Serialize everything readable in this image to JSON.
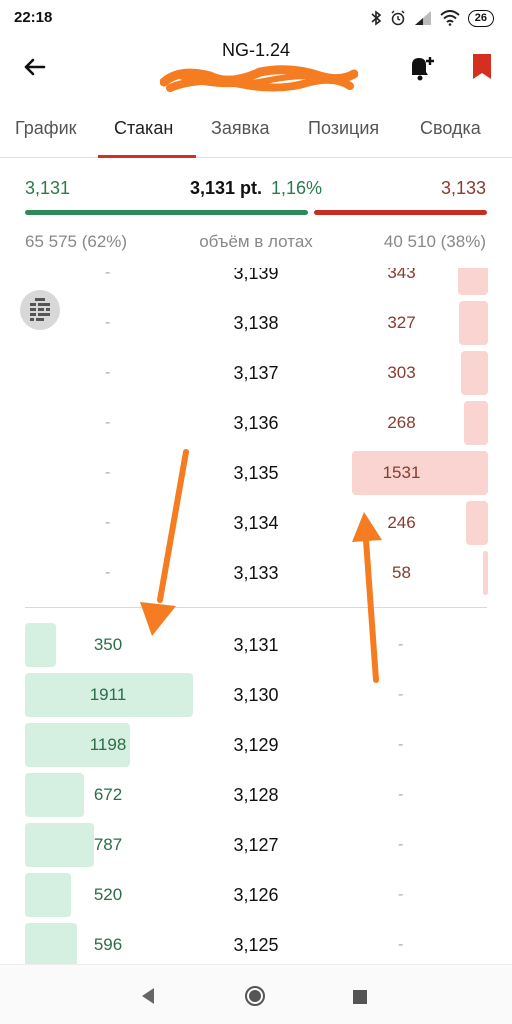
{
  "status_bar": {
    "time": "22:18",
    "battery": "26",
    "icons": [
      "bluetooth-icon",
      "alarm-icon",
      "signal-icon",
      "wifi-icon",
      "battery-icon"
    ]
  },
  "header": {
    "title": "NG-1.24",
    "subtitle": "",
    "back_icon": "arrow-left-icon",
    "alert_icon": "bell-plus-icon",
    "bookmark_icon": "bookmark-icon"
  },
  "tabs": [
    {
      "label": "График",
      "active": false
    },
    {
      "label": "Стакан",
      "active": true
    },
    {
      "label": "Заявка",
      "active": false
    },
    {
      "label": "Позиция",
      "active": false
    },
    {
      "label": "Сводка",
      "active": false
    }
  ],
  "summary": {
    "bid_price": "3,131",
    "center_price": "3,131 pt.",
    "change_pct": "1,16%",
    "ask_price": "3,133",
    "bid_volume": "65 575 (62%)",
    "volume_label": "объём в лотах",
    "ask_volume": "40 510 (38%)",
    "bid_share": 0.62,
    "ask_share": 0.38
  },
  "order_book": {
    "asks": [
      {
        "bid": "-",
        "price": "3,139",
        "ask": "343",
        "ask_value": 343
      },
      {
        "bid": "-",
        "price": "3,138",
        "ask": "327",
        "ask_value": 327
      },
      {
        "bid": "-",
        "price": "3,137",
        "ask": "303",
        "ask_value": 303
      },
      {
        "bid": "-",
        "price": "3,136",
        "ask": "268",
        "ask_value": 268
      },
      {
        "bid": "-",
        "price": "3,135",
        "ask": "1531",
        "ask_value": 1531
      },
      {
        "bid": "-",
        "price": "3,134",
        "ask": "246",
        "ask_value": 246
      },
      {
        "bid": "-",
        "price": "3,133",
        "ask": "58",
        "ask_value": 58
      }
    ],
    "bids": [
      {
        "bid": "350",
        "bid_value": 350,
        "price": "3,131",
        "ask": "-"
      },
      {
        "bid": "1911",
        "bid_value": 1911,
        "price": "3,130",
        "ask": "-"
      },
      {
        "bid": "1198",
        "bid_value": 1198,
        "price": "3,129",
        "ask": "-"
      },
      {
        "bid": "672",
        "bid_value": 672,
        "price": "3,128",
        "ask": "-"
      },
      {
        "bid": "787",
        "bid_value": 787,
        "price": "3,127",
        "ask": "-"
      },
      {
        "bid": "520",
        "bid_value": 520,
        "price": "3,126",
        "ask": "-"
      },
      {
        "bid": "596",
        "bid_value": 596,
        "price": "3,125",
        "ask": "-"
      }
    ],
    "fab_icon": "order-book-view-icon"
  },
  "colors": {
    "accent_red": "#d5301f",
    "bid_green": "#2b7a4b",
    "ask_red": "#8a3a2e",
    "arrow_orange": "#f57c20"
  },
  "nav_bar": {
    "icons": [
      "nav-back-icon",
      "nav-home-icon",
      "nav-recents-icon"
    ]
  }
}
